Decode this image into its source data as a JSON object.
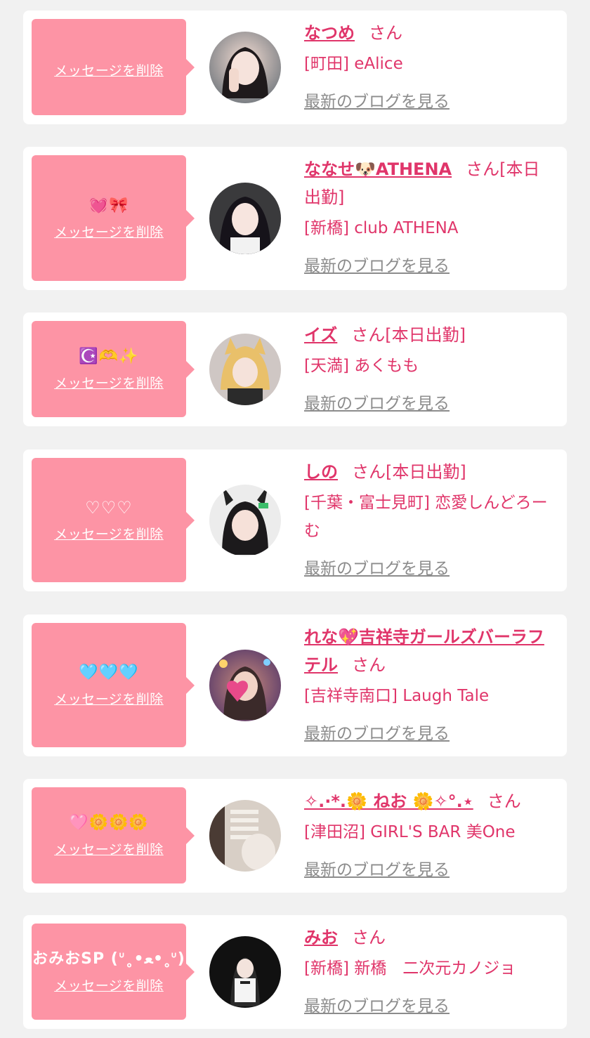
{
  "delete_label": "メッセージを削除",
  "blog_label": "最新のブログを見る",
  "colors": {
    "accent": "#e0356a",
    "bubble": "#fd94a5",
    "background": "#f1f1f1",
    "link_gray": "#8c8c8c"
  },
  "items": [
    {
      "memo": "",
      "name": "なつめ",
      "suffix": "さん",
      "shop": "[町田] eAlice",
      "avatar_icon": "avatar-photo"
    },
    {
      "memo": "💓🎀",
      "name": "ななせ🐶ATHENA",
      "suffix": "さん[本日出勤]",
      "shop": "[新橋] club ATHENA",
      "avatar_icon": "avatar-photo"
    },
    {
      "memo": "☪️🫶✨",
      "name": "イズ",
      "suffix": "さん[本日出勤]",
      "shop": "[天満] あくもも",
      "avatar_icon": "avatar-photo"
    },
    {
      "memo": "♡♡♡",
      "name": "しの",
      "suffix": "さん[本日出勤]",
      "shop": "[千葉・富士見町] 恋愛しんどろーむ",
      "avatar_icon": "avatar-photo"
    },
    {
      "memo": "🩵🩵🩵",
      "name": "れな💖吉祥寺ガールズバーラフテル",
      "suffix": "さん",
      "shop": "[吉祥寺南口] Laugh Tale",
      "avatar_icon": "avatar-photo"
    },
    {
      "memo": "🩷🌼🌼🌼",
      "name": "✧.·*.🌼 ねお 🌼✧°.⋆",
      "suffix": "さん",
      "shop": "[津田沼] GIRL'S BAR 美One",
      "avatar_icon": "avatar-photo"
    },
    {
      "memo": "おみおSP (ᐡ˳•ﻌ•˳ᐡ)",
      "name": "みお",
      "suffix": "さん",
      "shop": "[新橋] 新橋　二次元カノジョ",
      "avatar_icon": "avatar-photo"
    }
  ]
}
